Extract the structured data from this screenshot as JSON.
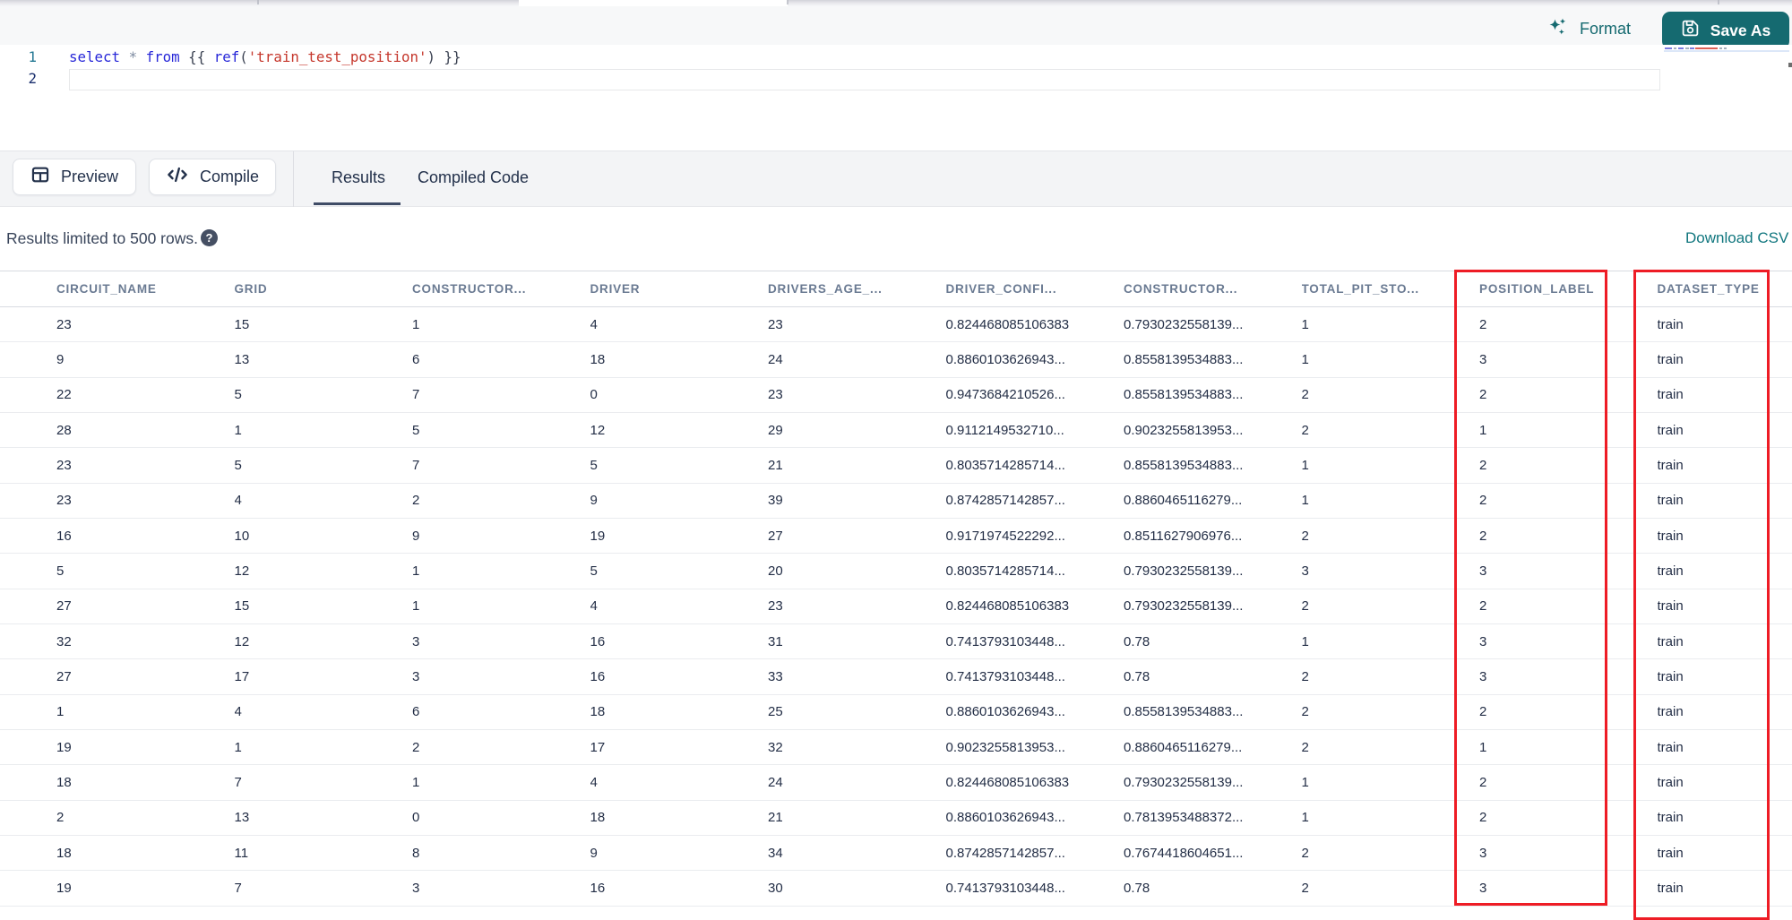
{
  "toolbar": {
    "format_label": "Format",
    "save_as_label": "Save As"
  },
  "editor": {
    "line_numbers": [
      "1",
      "2"
    ],
    "code_tokens": [
      {
        "text": "select",
        "type": "kw"
      },
      {
        "text": " ",
        "type": "pl"
      },
      {
        "text": "*",
        "type": "op"
      },
      {
        "text": " ",
        "type": "pl"
      },
      {
        "text": "from",
        "type": "kw"
      },
      {
        "text": " {{ ",
        "type": "pl"
      },
      {
        "text": "ref",
        "type": "kw"
      },
      {
        "text": "(",
        "type": "pl"
      },
      {
        "text": "'train_test_position'",
        "type": "str"
      },
      {
        "text": ") }}",
        "type": "pl"
      }
    ]
  },
  "actions": {
    "preview_label": "Preview",
    "compile_label": "Compile"
  },
  "tabs": [
    {
      "label": "Results",
      "active": true
    },
    {
      "label": "Compiled Code",
      "active": false
    }
  ],
  "results_bar": {
    "info_text": "Results limited to 500 rows.",
    "help_icon": "?",
    "download_label": "Download CSV"
  },
  "table": {
    "columns": [
      "CIRCUIT_NAME",
      "GRID",
      "CONSTRUCTOR...",
      "DRIVER",
      "DRIVERS_AGE_...",
      "DRIVER_CONFI...",
      "CONSTRUCTOR...",
      "TOTAL_PIT_STO...",
      "POSITION_LABEL",
      "DATASET_TYPE"
    ],
    "rows": [
      [
        "23",
        "15",
        "1",
        "4",
        "23",
        "0.824468085106383",
        "0.7930232558139...",
        "1",
        "2",
        "train"
      ],
      [
        "9",
        "13",
        "6",
        "18",
        "24",
        "0.8860103626943...",
        "0.8558139534883...",
        "1",
        "3",
        "train"
      ],
      [
        "22",
        "5",
        "7",
        "0",
        "23",
        "0.9473684210526...",
        "0.8558139534883...",
        "2",
        "2",
        "train"
      ],
      [
        "28",
        "1",
        "5",
        "12",
        "29",
        "0.9112149532710...",
        "0.9023255813953...",
        "2",
        "1",
        "train"
      ],
      [
        "23",
        "5",
        "7",
        "5",
        "21",
        "0.8035714285714...",
        "0.8558139534883...",
        "1",
        "2",
        "train"
      ],
      [
        "23",
        "4",
        "2",
        "9",
        "39",
        "0.8742857142857...",
        "0.8860465116279...",
        "1",
        "2",
        "train"
      ],
      [
        "16",
        "10",
        "9",
        "19",
        "27",
        "0.9171974522292...",
        "0.8511627906976...",
        "2",
        "2",
        "train"
      ],
      [
        "5",
        "12",
        "1",
        "5",
        "20",
        "0.8035714285714...",
        "0.7930232558139...",
        "3",
        "3",
        "train"
      ],
      [
        "27",
        "15",
        "1",
        "4",
        "23",
        "0.824468085106383",
        "0.7930232558139...",
        "2",
        "2",
        "train"
      ],
      [
        "32",
        "12",
        "3",
        "16",
        "31",
        "0.7413793103448...",
        "0.78",
        "1",
        "3",
        "train"
      ],
      [
        "27",
        "17",
        "3",
        "16",
        "33",
        "0.7413793103448...",
        "0.78",
        "2",
        "3",
        "train"
      ],
      [
        "1",
        "4",
        "6",
        "18",
        "25",
        "0.8860103626943...",
        "0.8558139534883...",
        "2",
        "2",
        "train"
      ],
      [
        "19",
        "1",
        "2",
        "17",
        "32",
        "0.9023255813953...",
        "0.8860465116279...",
        "2",
        "1",
        "train"
      ],
      [
        "18",
        "7",
        "1",
        "4",
        "24",
        "0.824468085106383",
        "0.7930232558139...",
        "1",
        "2",
        "train"
      ],
      [
        "2",
        "13",
        "0",
        "18",
        "21",
        "0.8860103626943...",
        "0.7813953488372...",
        "1",
        "2",
        "train"
      ],
      [
        "18",
        "11",
        "8",
        "9",
        "34",
        "0.8742857142857...",
        "0.7674418604651...",
        "2",
        "3",
        "train"
      ],
      [
        "19",
        "7",
        "3",
        "16",
        "30",
        "0.7413793103448...",
        "0.78",
        "2",
        "3",
        "train"
      ]
    ]
  },
  "annotations": {
    "highlight_color": "#ee1c25",
    "boxes": [
      {
        "target_column": "POSITION_LABEL"
      },
      {
        "target_column": "DATASET_TYPE"
      }
    ]
  },
  "colors": {
    "accent_teal": "#156a70",
    "link_teal": "#10767e",
    "annotation_red": "#ee1c25"
  }
}
